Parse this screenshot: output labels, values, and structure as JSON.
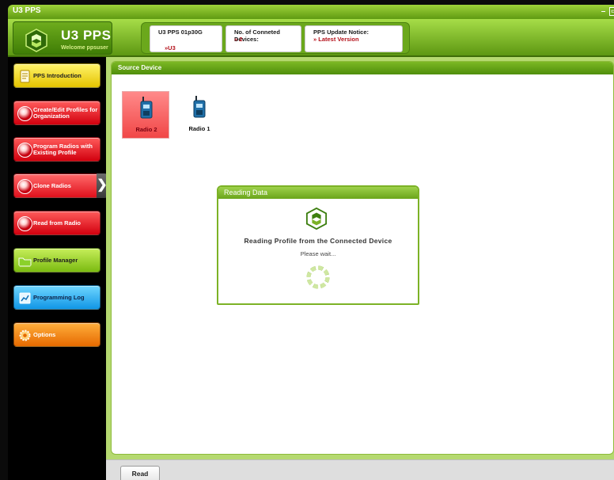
{
  "window": {
    "title": "U3 PPS",
    "min_glyph": "–",
    "max_glyph": "▭"
  },
  "header": {
    "app_name": "U3 PPS",
    "welcome": "Welcome ppsuser",
    "cards": [
      {
        "label": "U3 PPS 01p30G",
        "value": "»U3"
      },
      {
        "label": "No. of Conneted Devices:",
        "value": "» 2"
      },
      {
        "label": "PPS Update Notice:",
        "value": "» Latest Version"
      }
    ]
  },
  "sidebar": {
    "items": [
      {
        "label": "PPS Introduction"
      },
      {
        "label": "Create/Edit Profiles for Organization"
      },
      {
        "label": "Program Radios with Existing Profile"
      },
      {
        "label": "Clone Radios"
      },
      {
        "label": "Read from Radio"
      },
      {
        "label": "Profile Manager"
      },
      {
        "label": "Programming Log"
      },
      {
        "label": "Options"
      }
    ],
    "selected_arrow": "❯"
  },
  "main": {
    "panel_title": "Source Device",
    "devices": [
      {
        "name": "Radio 2",
        "selected": true
      },
      {
        "name": "Radio 1",
        "selected": false
      }
    ]
  },
  "dialog": {
    "title": "Reading Data",
    "message": "Reading Profile from the  Connected Device",
    "wait": "Please wait..."
  },
  "bottom": {
    "read_button": "Read"
  },
  "colors": {
    "brand_green": "#6ba81c",
    "alert_red": "#b4121b",
    "selected_device": "#f14747"
  }
}
